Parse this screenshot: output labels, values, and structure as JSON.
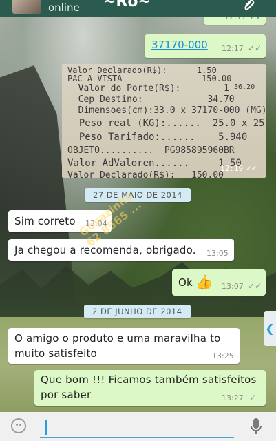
{
  "header": {
    "contact_status": "online",
    "contact_name": "~Ro~"
  },
  "messages": {
    "m0_time": "12:17",
    "m1_text": "37170-000",
    "m1_time": "12:17",
    "m2_time": "12:19",
    "date1": "27 DE MAIO DE 2014",
    "m3_text": "Sim correto",
    "m3_time": "13:04",
    "m4_text": "Ja chegou a recomenda, obrigado.",
    "m4_time": "13:05",
    "m5_text": "Ok",
    "m5_time": "13:07",
    "date2": "2 DE JUNHO DE 2014",
    "m6_text": "O amigo o produto e uma maravilha to muito satisfeito",
    "m6_time": "13:25",
    "m7_text": "Que bom !!! Ficamos também satisfeitos por saber",
    "m7_time": "13:27"
  },
  "receipt": {
    "lines": [
      "Valor Declarado(R$):      1.50",
      "PAC A VISTA                150.00",
      "  Valor do Porte(R$):        1",
      "  Cep Destino:            34.70",
      "  Dimensoes(cm):33.0 x 37170-000 (MG)",
      "  Peso real (KG):......  25.0 x 25.",
      "  Peso Tarifado:......    5.940",
      "OBJETO..........  PG985895960BR",
      "Valor AdValoren......     1.50",
      "Valor Declarado(R$):   150.00"
    ],
    "side_value": "36.20"
  },
  "watermark": {
    "line1": "Goyazinho",
    "line2": "62 8565 ..."
  },
  "icons": {
    "thumbs_up": "👍",
    "double_tick": "✓✓",
    "single_tick": "✓"
  }
}
